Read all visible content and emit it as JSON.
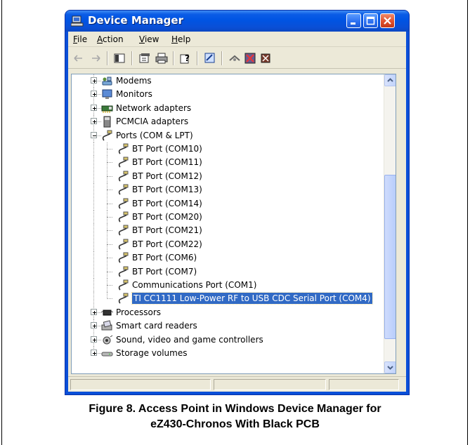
{
  "window": {
    "title": "Device Manager"
  },
  "menu": [
    "File",
    "Action",
    "View",
    "Help"
  ],
  "menu_underline": [
    "F",
    "A",
    "V",
    "H"
  ],
  "toolbar_icons": [
    "back-arrow-icon",
    "forward-arrow-icon",
    "show-hide-console-tree-icon",
    "properties-icon",
    "print-icon",
    "help-icon",
    "scan-hardware-icon",
    "update-driver-icon",
    "disable-device-icon",
    "uninstall-device-icon"
  ],
  "tree": [
    {
      "label": "Modems",
      "level": 0,
      "expander": "+",
      "icon": "modem-icon"
    },
    {
      "label": "Monitors",
      "level": 0,
      "expander": "+",
      "icon": "monitor-icon"
    },
    {
      "label": "Network adapters",
      "level": 0,
      "expander": "+",
      "icon": "network-adapter-icon"
    },
    {
      "label": "PCMCIA adapters",
      "level": 0,
      "expander": "+",
      "icon": "pcmcia-icon"
    },
    {
      "label": "Ports (COM & LPT)",
      "level": 0,
      "expander": "-",
      "icon": "port-icon"
    },
    {
      "label": "BT Port (COM10)",
      "level": 1,
      "icon": "port-icon"
    },
    {
      "label": "BT Port (COM11)",
      "level": 1,
      "icon": "port-icon"
    },
    {
      "label": "BT Port (COM12)",
      "level": 1,
      "icon": "port-icon"
    },
    {
      "label": "BT Port (COM13)",
      "level": 1,
      "icon": "port-icon"
    },
    {
      "label": "BT Port (COM14)",
      "level": 1,
      "icon": "port-icon"
    },
    {
      "label": "BT Port (COM20)",
      "level": 1,
      "icon": "port-icon"
    },
    {
      "label": "BT Port (COM21)",
      "level": 1,
      "icon": "port-icon"
    },
    {
      "label": "BT Port (COM22)",
      "level": 1,
      "icon": "port-icon"
    },
    {
      "label": "BT Port (COM6)",
      "level": 1,
      "icon": "port-icon"
    },
    {
      "label": "BT Port (COM7)",
      "level": 1,
      "icon": "port-icon"
    },
    {
      "label": "Communications Port (COM1)",
      "level": 1,
      "icon": "port-icon"
    },
    {
      "label": "TI CC1111 Low-Power RF to USB CDC Serial Port (COM4)",
      "level": 1,
      "icon": "port-icon",
      "selected": true
    },
    {
      "label": "Processors",
      "level": 0,
      "expander": "+",
      "icon": "processor-icon"
    },
    {
      "label": "Smart card readers",
      "level": 0,
      "expander": "+",
      "icon": "smart-card-reader-icon"
    },
    {
      "label": "Sound, video and game controllers",
      "level": 0,
      "expander": "+",
      "icon": "sound-icon"
    },
    {
      "label": "Storage volumes",
      "level": 0,
      "expander": "+",
      "icon": "storage-volume-icon"
    }
  ],
  "caption": {
    "line1": "Figure 8. Access Point in Windows Device Manager for",
    "line2": "eZ430-Chronos With Black PCB"
  },
  "colors": {
    "titlebar": "#0054e3",
    "selection": "#316ac5",
    "chrome": "#ece9d8"
  }
}
